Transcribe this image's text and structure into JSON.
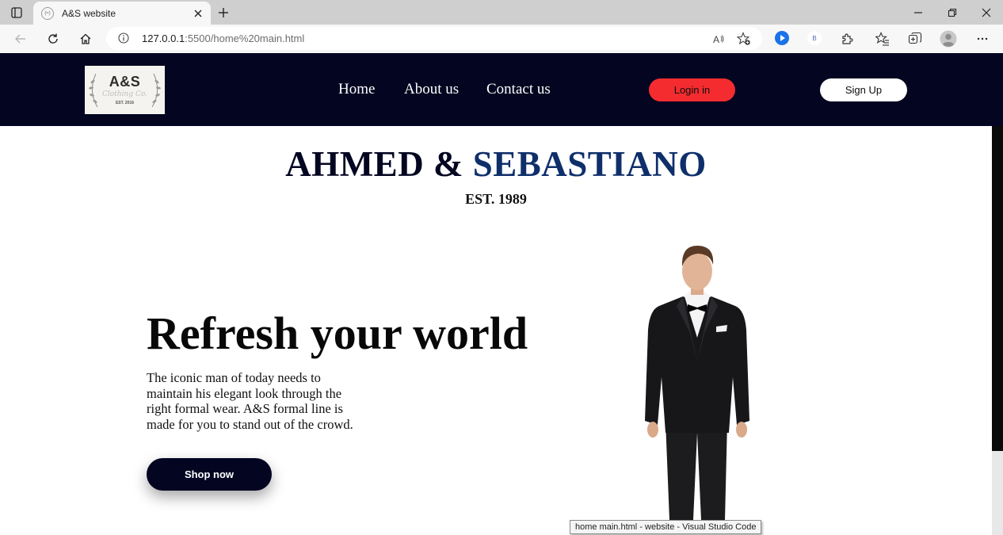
{
  "browser": {
    "tab_title": "A&S website",
    "tab_favicon_text": "(≈)",
    "url_host": "127.0.0.1",
    "url_rest": ":5500/home%20main.html",
    "extension_b_label": "B",
    "status_tooltip": "home main.html - website - Visual Studio Code"
  },
  "site": {
    "logo": {
      "main": "A&S",
      "sub": "Clothing Co.",
      "est": "EST. 2016"
    },
    "nav": {
      "home": "Home",
      "about": "About us",
      "contact": "Contact us"
    },
    "login_label": "Login in",
    "signup_label": "Sign Up",
    "brand_part1": "AHMED & ",
    "brand_part2": "SEBASTIANO",
    "est": "EST. 1989",
    "hero": {
      "title": "Refresh your world",
      "text": "The iconic man of today needs to maintain his elegant look through the right formal wear. A&S formal line is made for you to stand out of the crowd.",
      "button": "Shop now"
    }
  },
  "colors": {
    "nav_bg": "#030521",
    "login_bg": "#f42c2f",
    "brand_accent": "#0f2f6a"
  }
}
